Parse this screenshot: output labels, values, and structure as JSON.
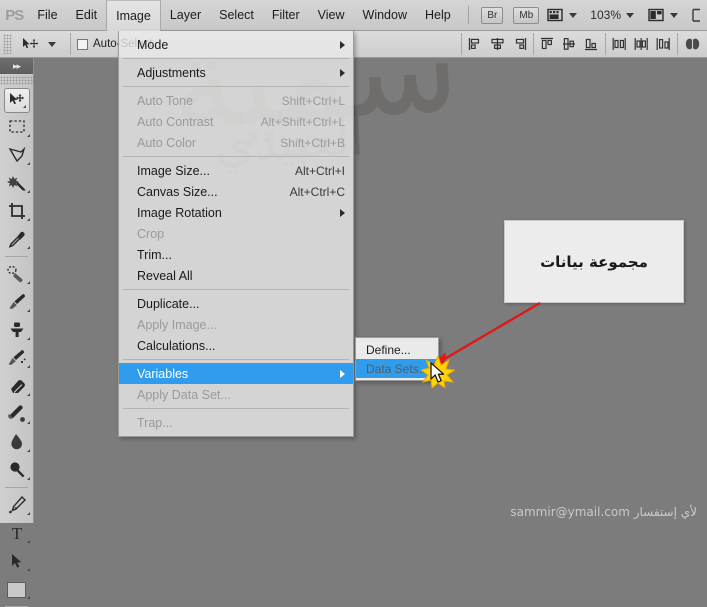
{
  "app": {
    "logo": "PS",
    "zoom_level": "103%"
  },
  "menubar": {
    "items": [
      {
        "label": "File",
        "active": false
      },
      {
        "label": "Edit",
        "active": false
      },
      {
        "label": "Image",
        "active": true
      },
      {
        "label": "Layer",
        "active": false
      },
      {
        "label": "Select",
        "active": false
      },
      {
        "label": "Filter",
        "active": false
      },
      {
        "label": "View",
        "active": false
      },
      {
        "label": "Window",
        "active": false
      },
      {
        "label": "Help",
        "active": false
      }
    ],
    "bridge_button": "Br",
    "minibridge_button": "Mb",
    "extras_icon": "filmstrip-icon",
    "arrange_icon": "arrange-documents-icon",
    "screenmode_icon": "screen-mode-icon"
  },
  "optionsbar": {
    "tool_icon": "move-tool-icon",
    "auto_select_label": "Auto-Select:",
    "auto_select_checked": false,
    "align_icons": [
      "align-left-edges",
      "align-horizontal-centers",
      "align-right-edges",
      "align-top-edges",
      "align-vertical-centers",
      "align-bottom-edges",
      "distribute-top-edges",
      "distribute-vertical-centers",
      "distribute-bottom-edges",
      "distribute-left-edges",
      "distribute-horizontal-centers",
      "distribute-right-edges",
      "auto-align-layers"
    ]
  },
  "toolpanel": {
    "collapse_glyph": "▸▸",
    "tools": [
      {
        "name": "move-tool",
        "selected": true
      },
      {
        "name": "rectangular-marquee-tool",
        "selected": false
      },
      {
        "name": "lasso-tool",
        "selected": false
      },
      {
        "name": "quick-selection-tool",
        "selected": false
      },
      {
        "name": "crop-tool",
        "selected": false
      },
      {
        "name": "eyedropper-tool",
        "selected": false
      },
      {
        "name": "spot-healing-brush-tool",
        "selected": false
      },
      {
        "name": "brush-tool",
        "selected": false
      },
      {
        "name": "clone-stamp-tool",
        "selected": false
      },
      {
        "name": "history-brush-tool",
        "selected": false
      },
      {
        "name": "eraser-tool",
        "selected": false
      },
      {
        "name": "gradient-tool",
        "selected": false
      },
      {
        "name": "blur-tool",
        "selected": false
      },
      {
        "name": "dodge-tool",
        "selected": false
      },
      {
        "name": "pen-tool",
        "selected": false
      },
      {
        "name": "horizontal-type-tool",
        "selected": false,
        "glyph": "T"
      },
      {
        "name": "path-selection-tool",
        "selected": false
      },
      {
        "name": "rectangle-tool",
        "selected": false
      }
    ]
  },
  "image_menu": {
    "groups": [
      [
        {
          "label": "Mode",
          "shortcut": "",
          "submenu": true,
          "disabled": false,
          "highlighted": false
        }
      ],
      [
        {
          "label": "Adjustments",
          "shortcut": "",
          "submenu": true,
          "disabled": false,
          "highlighted": false
        }
      ],
      [
        {
          "label": "Auto Tone",
          "shortcut": "Shift+Ctrl+L",
          "submenu": false,
          "disabled": true,
          "highlighted": false
        },
        {
          "label": "Auto Contrast",
          "shortcut": "Alt+Shift+Ctrl+L",
          "submenu": false,
          "disabled": true,
          "highlighted": false
        },
        {
          "label": "Auto Color",
          "shortcut": "Shift+Ctrl+B",
          "submenu": false,
          "disabled": true,
          "highlighted": false
        }
      ],
      [
        {
          "label": "Image Size...",
          "shortcut": "Alt+Ctrl+I",
          "submenu": false,
          "disabled": false,
          "highlighted": false
        },
        {
          "label": "Canvas Size...",
          "shortcut": "Alt+Ctrl+C",
          "submenu": false,
          "disabled": false,
          "highlighted": false
        },
        {
          "label": "Image Rotation",
          "shortcut": "",
          "submenu": true,
          "disabled": false,
          "highlighted": false
        },
        {
          "label": "Crop",
          "shortcut": "",
          "submenu": false,
          "disabled": true,
          "highlighted": false
        },
        {
          "label": "Trim...",
          "shortcut": "",
          "submenu": false,
          "disabled": false,
          "highlighted": false
        },
        {
          "label": "Reveal All",
          "shortcut": "",
          "submenu": false,
          "disabled": false,
          "highlighted": false
        }
      ],
      [
        {
          "label": "Duplicate...",
          "shortcut": "",
          "submenu": false,
          "disabled": false,
          "highlighted": false
        },
        {
          "label": "Apply Image...",
          "shortcut": "",
          "submenu": false,
          "disabled": true,
          "highlighted": false
        },
        {
          "label": "Calculations...",
          "shortcut": "",
          "submenu": false,
          "disabled": false,
          "highlighted": false
        }
      ],
      [
        {
          "label": "Variables",
          "shortcut": "",
          "submenu": true,
          "disabled": false,
          "highlighted": true
        },
        {
          "label": "Apply Data Set...",
          "shortcut": "",
          "submenu": false,
          "disabled": true,
          "highlighted": false
        }
      ],
      [
        {
          "label": "Trap...",
          "shortcut": "",
          "submenu": false,
          "disabled": true,
          "highlighted": false
        }
      ]
    ]
  },
  "variables_submenu": {
    "items": [
      {
        "label": "Define...",
        "highlighted": false
      },
      {
        "label": "Data Sets...",
        "highlighted": true
      }
    ]
  },
  "callout": {
    "text": "مجموعة بيانات"
  },
  "watermark": {
    "calligraphy": "سمية",
    "calligraphy2": "العبيدي"
  },
  "credit": {
    "text": "sammir@ymail.com لأي إستفسار"
  },
  "colors": {
    "highlight": "#2f9ced",
    "arrow": "#e11717",
    "burst": "#ffd400",
    "chrome": "#d0d0d0",
    "canvas": "#7c7c7c"
  }
}
